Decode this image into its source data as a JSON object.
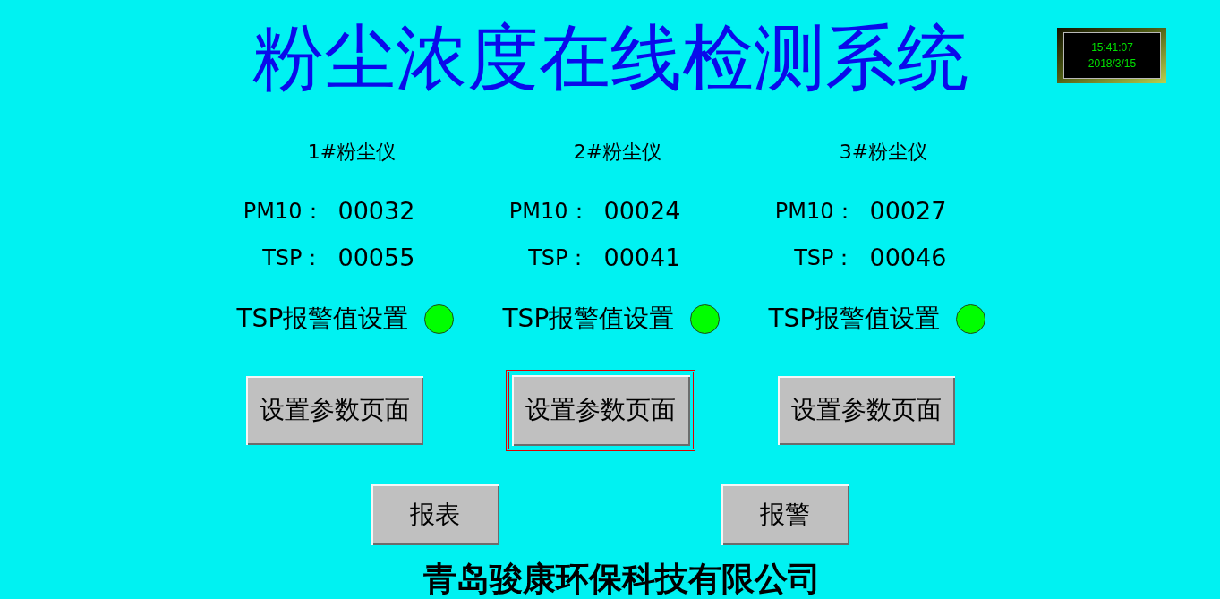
{
  "title": "粉尘浓度在线检测系统",
  "clock": {
    "time": "15:41:07",
    "date": "2018/3/15"
  },
  "devices": [
    {
      "name": "1#粉尘仪",
      "readings": [
        {
          "label": "PM10：",
          "value": "00032"
        },
        {
          "label": "TSP：",
          "value": "00055"
        }
      ],
      "alarm_label": "TSP报警值设置",
      "alarm": false,
      "button": {
        "label": "设置参数页面",
        "focused": false
      }
    },
    {
      "name": "2#粉尘仪",
      "readings": [
        {
          "label": "PM10：",
          "value": "00024"
        },
        {
          "label": "TSP：",
          "value": "00041"
        }
      ],
      "alarm_label": "TSP报警值设置",
      "alarm": false,
      "button": {
        "label": "设置参数页面",
        "focused": true
      }
    },
    {
      "name": "3#粉尘仪",
      "readings": [
        {
          "label": "PM10：",
          "value": "00027"
        },
        {
          "label": "TSP：",
          "value": "00046"
        }
      ],
      "alarm_label": "TSP报警值设置",
      "alarm": false,
      "button": {
        "label": "设置参数页面",
        "focused": false
      }
    }
  ],
  "nav_buttons": [
    {
      "label": "报表"
    },
    {
      "label": "报警"
    }
  ],
  "footer": "青岛骏康环保科技有限公司"
}
